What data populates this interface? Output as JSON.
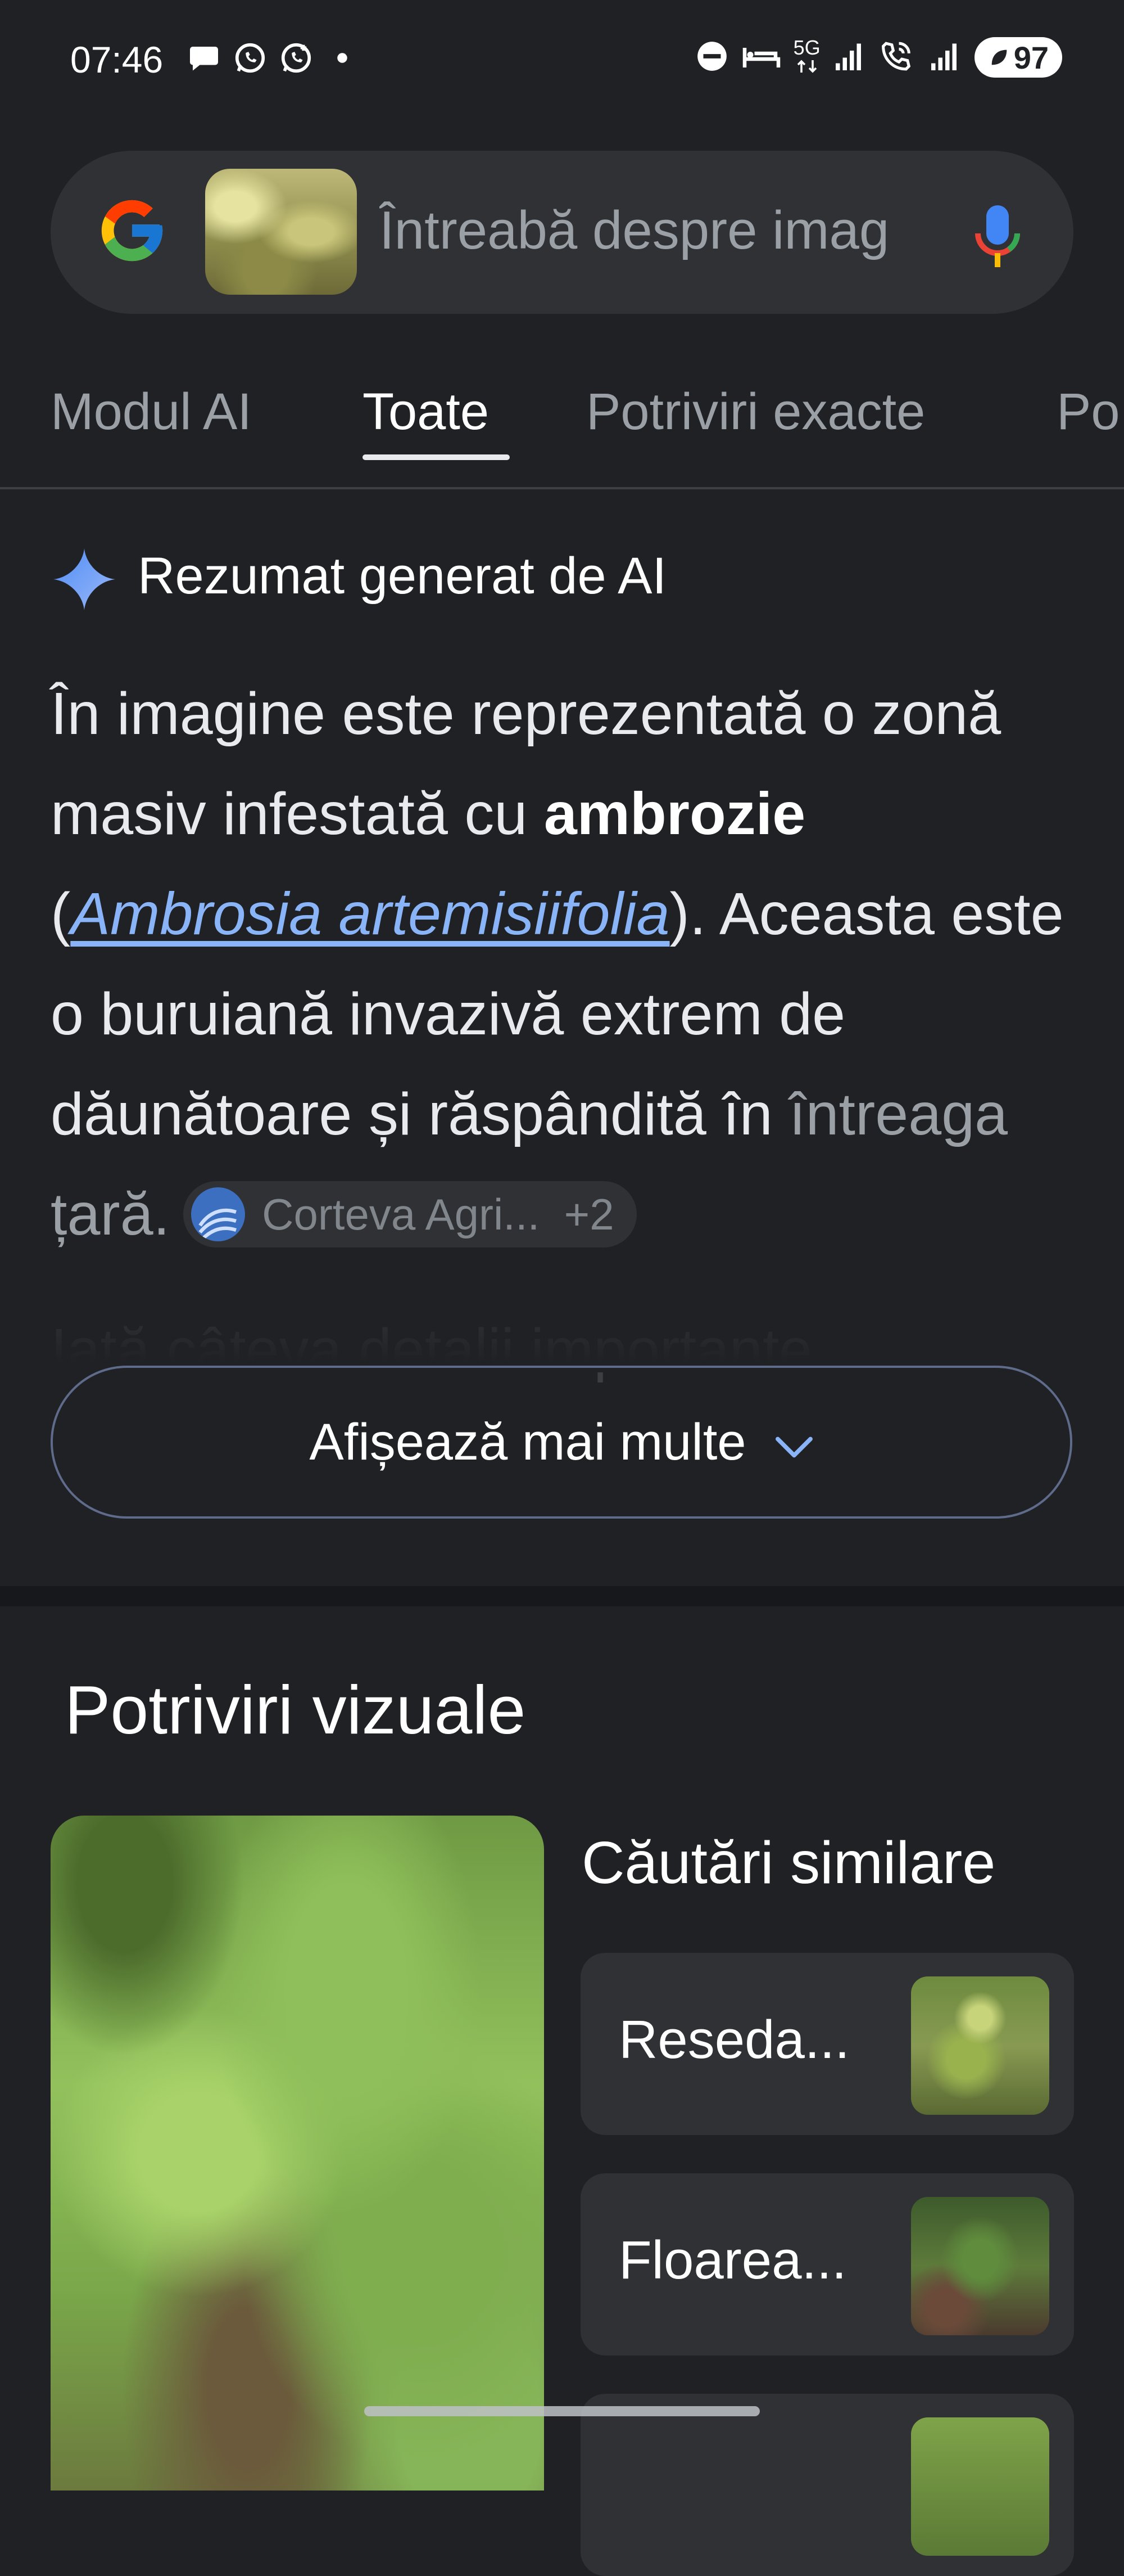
{
  "status_bar": {
    "time": "07:46",
    "network": "5G",
    "battery": "97",
    "icons": [
      "message-icon",
      "whatsapp-icon",
      "whatsapp-business-icon",
      "dot-icon",
      "dnd-icon",
      "sleep-icon",
      "network-5g-icon",
      "signal-icon",
      "wifi-call-icon",
      "signal-icon",
      "battery-icon"
    ]
  },
  "search": {
    "placeholder": "Întreabă despre imag",
    "logo": "google-logo",
    "thumbnail": "query-image-thumbnail",
    "mic": "mic-icon"
  },
  "tabs": [
    {
      "label": "Modul AI",
      "active": false
    },
    {
      "label": "Toate",
      "active": true
    },
    {
      "label": "Potriviri exacte",
      "active": false
    },
    {
      "label": "Po",
      "active": false
    }
  ],
  "ai_overview": {
    "heading": "Rezumat generat de AI",
    "body_1": "În imagine este reprezentată o zonă masiv infestată cu ",
    "bold_term": "ambrozie",
    "paren_open": " (",
    "link_text": "Ambrosia artemisiifolia",
    "paren_close": "). Aceasta este o buruiană invazivă extrem de dăunătoare și răspândită în ",
    "faded_text": "întreaga țară.",
    "source_chip": {
      "label": "Corteva Agri...",
      "more": "+2"
    },
    "fade_line": "Iată câteva detalii importante",
    "show_more": "Afișează mai multe"
  },
  "visual_matches": {
    "title": "Potriviri vizuale",
    "similar_title": "Căutări similare",
    "similar": [
      {
        "label": "Reseda..."
      },
      {
        "label": "Floarea..."
      },
      {
        "label": ""
      }
    ]
  },
  "colors": {
    "background": "#202124",
    "surface": "#303134",
    "link": "#8ab4f8",
    "text": "#e8eaed",
    "muted": "#9aa0a6"
  }
}
